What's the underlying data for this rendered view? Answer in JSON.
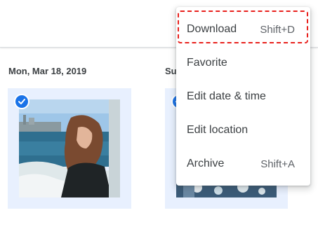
{
  "sections": [
    {
      "date": "Mon, Mar 18, 2019"
    },
    {
      "date": "Su"
    }
  ],
  "menu": {
    "items": [
      {
        "label": "Download",
        "shortcut": "Shift+D"
      },
      {
        "label": "Favorite",
        "shortcut": ""
      },
      {
        "label": "Edit date & time",
        "shortcut": ""
      },
      {
        "label": "Edit location",
        "shortcut": ""
      },
      {
        "label": "Archive",
        "shortcut": "Shift+A"
      }
    ]
  },
  "colors": {
    "accent": "#1a73e8",
    "selection_bg": "#e8f0fe",
    "highlight_border": "#e8201c"
  },
  "icons": {
    "selected": "check-circle-icon"
  }
}
